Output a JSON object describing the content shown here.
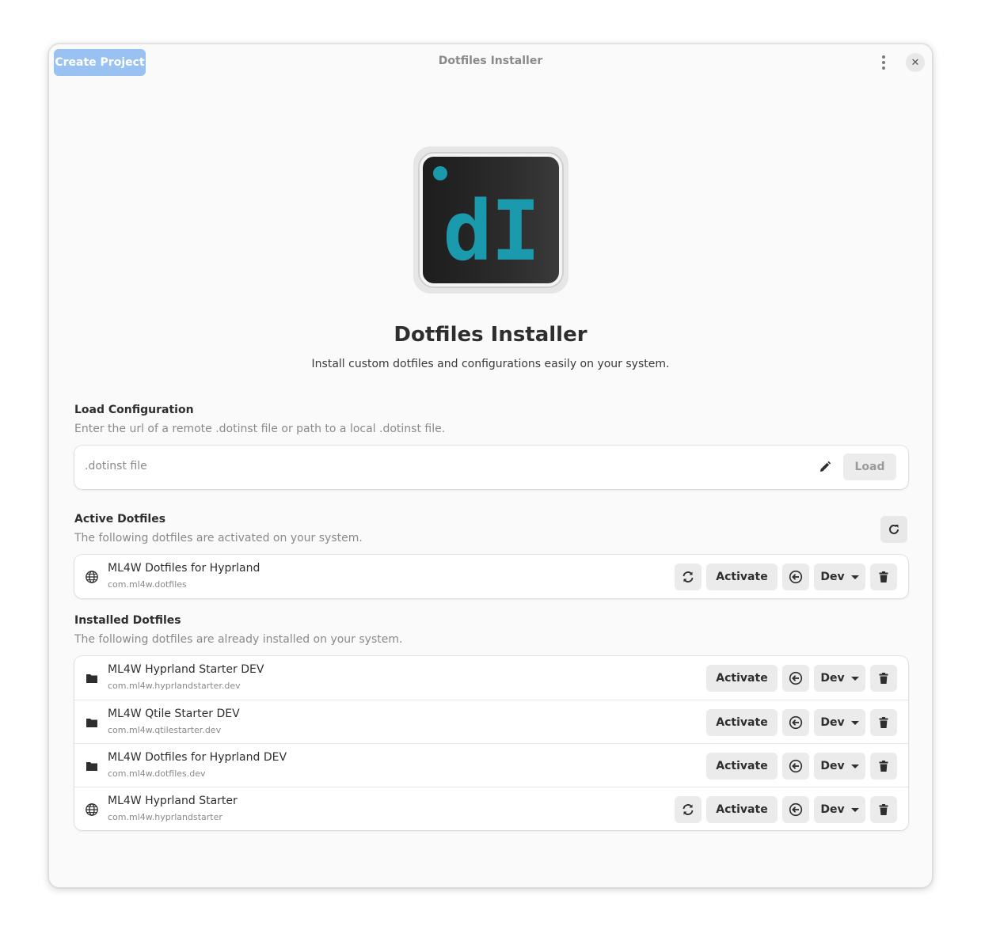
{
  "window": {
    "title": "Dotfiles Installer",
    "create_button": "Create Project"
  },
  "hero": {
    "logo_text": "dI",
    "title": "Dotfiles Installer",
    "description": "Install custom dotfiles and configurations easily on your system."
  },
  "load_config": {
    "title": "Load Configuration",
    "subtitle": "Enter the url of a remote .dotinst file or path to a local .dotinst file.",
    "input_placeholder": ".dotinst file",
    "input_value": "",
    "load_button": "Load"
  },
  "active": {
    "title": "Active Dotfiles",
    "subtitle": "The following dotfiles are activated on your system.",
    "items": [
      {
        "name": "ML4W Dotfiles for Hyprland",
        "id": "com.ml4w.dotfiles",
        "icon": "globe-icon",
        "has_sync": true,
        "activate": "Activate",
        "channel": "Dev"
      }
    ]
  },
  "installed": {
    "title": "Installed Dotfiles",
    "subtitle": "The following dotfiles are already installed on your system.",
    "items": [
      {
        "name": "ML4W Hyprland Starter DEV",
        "id": "com.ml4w.hyprlandstarter.dev",
        "icon": "folder-icon",
        "has_sync": false,
        "activate": "Activate",
        "channel": "Dev"
      },
      {
        "name": "ML4W Qtile Starter DEV",
        "id": "com.ml4w.qtilestarter.dev",
        "icon": "folder-icon",
        "has_sync": false,
        "activate": "Activate",
        "channel": "Dev"
      },
      {
        "name": "ML4W Dotfiles for Hyprland DEV",
        "id": "com.ml4w.dotfiles.dev",
        "icon": "folder-icon",
        "has_sync": false,
        "activate": "Activate",
        "channel": "Dev"
      },
      {
        "name": "ML4W Hyprland Starter",
        "id": "com.ml4w.hyprlandstarter",
        "icon": "globe-icon",
        "has_sync": true,
        "activate": "Activate",
        "channel": "Dev"
      }
    ]
  },
  "colors": {
    "accent_light": "#99c1f1",
    "logo_teal": "#1a9aac",
    "window_bg": "#fafafa"
  }
}
